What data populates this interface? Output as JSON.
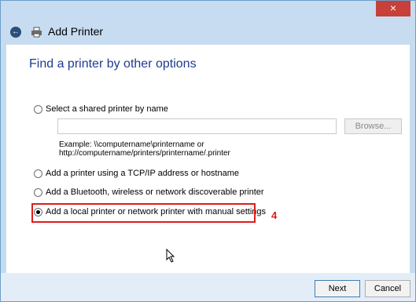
{
  "window": {
    "title": "Add Printer",
    "close_label": "×"
  },
  "page": {
    "heading": "Find a printer by other options"
  },
  "options": [
    {
      "label": "Select a shared printer by name",
      "checked": false
    },
    {
      "label": "Add a printer using a TCP/IP address or hostname",
      "checked": false
    },
    {
      "label": "Add a Bluetooth, wireless or network discoverable printer",
      "checked": false
    },
    {
      "label": "Add a local printer or network printer with manual settings",
      "checked": true
    }
  ],
  "shared_printer": {
    "input_value": "",
    "browse_label": "Browse...",
    "example_line1": "Example: \\\\computername\\printername or",
    "example_line2": "http://computername/printers/printername/.printer"
  },
  "annotation": {
    "step_number": "4",
    "color": "#e01b1b"
  },
  "footer": {
    "next_label": "Next",
    "cancel_label": "Cancel"
  },
  "icons": {
    "back": "back-arrow-icon",
    "printer": "printer-icon",
    "cursor": "mouse-cursor-icon"
  }
}
